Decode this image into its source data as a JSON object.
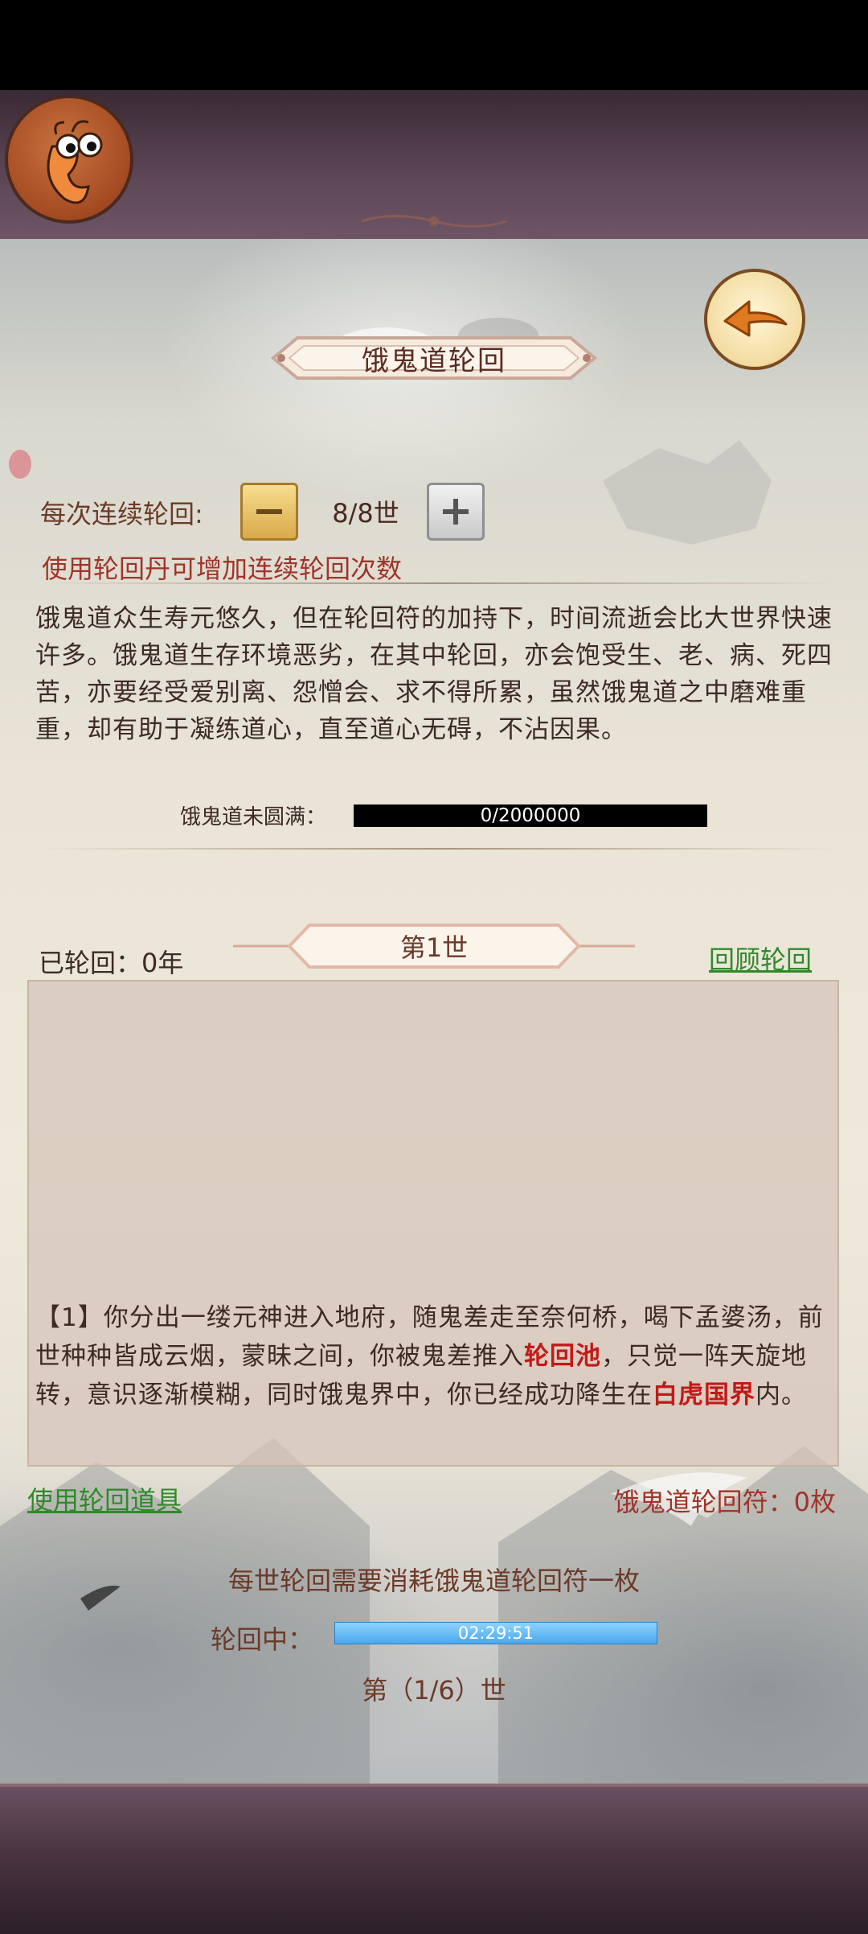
{
  "header": {
    "avatar_icon": "cartoon-shrimp-avatar-icon",
    "back_icon": "back-arrow-icon"
  },
  "panel": {
    "title": "饿鬼道轮回"
  },
  "continuous": {
    "label": "每次连续轮回:",
    "count": "8/8世",
    "minus_icon": "minus-icon",
    "plus_icon": "plus-icon",
    "hint": "使用轮回丹可增加连续轮回次数"
  },
  "description": "饿鬼道众生寿元悠久，但在轮回符的加持下，时间流逝会比大世界快速许多。饿鬼道生存环境恶劣，在其中轮回，亦会饱受生、老、病、死四苦，亦要经受爱别离、怨憎会、求不得所累，虽然饿鬼道之中磨难重重，却有助于凝练道心，直至道心无碍，不沾因果。",
  "completion": {
    "label": "饿鬼道未圆满：",
    "progress_text": "0/2000000",
    "progress_fraction": 0
  },
  "history": {
    "reincarnated": "已轮回：0年",
    "current_life": "第1世",
    "review_link": "回顾轮回"
  },
  "log": {
    "part1": "【1】你分出一缕元神进入地府，随鬼差走至奈何桥，喝下孟婆汤，前世种种皆成云烟，蒙昧之间，你被鬼差推入",
    "highlight1": "轮回池",
    "part2": "，只觉一阵天旋地转，意识逐渐模糊，同时饿鬼界中，你已经成功降生在",
    "highlight2": "白虎国界",
    "part3": "内。"
  },
  "footer": {
    "use_items": "使用轮回道具",
    "token_count": "饿鬼道轮回符：0枚",
    "cost_note": "每世轮回需要消耗饿鬼道轮回符一枚",
    "timer_label": "轮回中：",
    "timer_value": "02:29:51",
    "timer_fraction": 1,
    "life_counter": "第（1/6）世"
  },
  "colors": {
    "accent_red": "#a0342a",
    "link_green": "#2f8a2a",
    "highlight_red": "#c21a17"
  }
}
